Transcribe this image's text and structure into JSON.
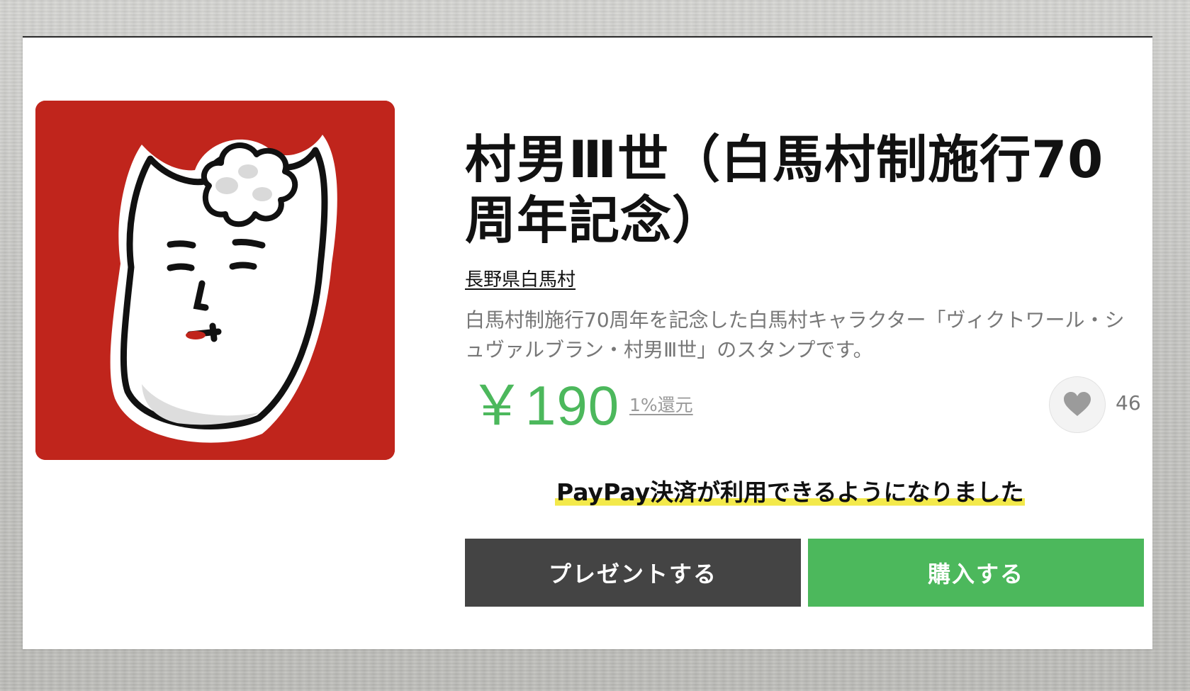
{
  "sticker": {
    "title": "村男Ⅲ世（白馬村制施行70周年記念）",
    "author": "長野県白馬村",
    "description": "白馬村制施行70周年を記念した白馬村キャラクター「ヴィクトワール・シュヴァルブラン・村男Ⅲ世」のスタンプです。",
    "price": "￥190",
    "cashback": "1%還元",
    "like_count": "46",
    "thumbnail_icon": "sticker-character-thumbnail"
  },
  "notice": {
    "text": "PayPay決済が利用できるようになりました",
    "highlight_color": "#f3e94a"
  },
  "actions": {
    "present_label": "プレゼントする",
    "buy_label": "購入する"
  },
  "colors": {
    "accent_green": "#4cb85c",
    "thumbnail_red": "#c0251c",
    "dark_button": "#444444"
  }
}
